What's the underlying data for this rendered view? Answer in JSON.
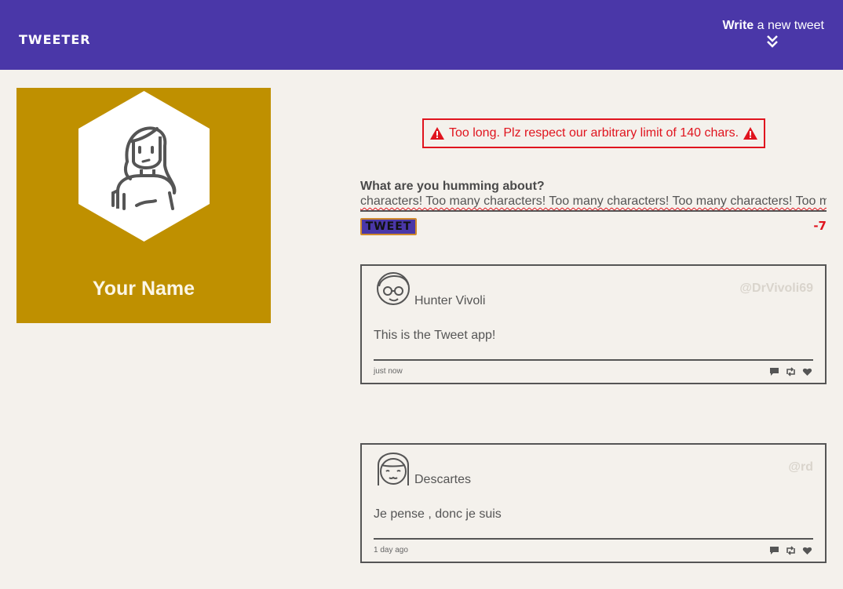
{
  "nav": {
    "brand": "TWEETER",
    "compose_bold": "Write",
    "compose_rest": " a new tweet"
  },
  "profile": {
    "name": "Your Name"
  },
  "error": {
    "message": "Too long. Plz respect our arbitrary limit of 140 chars."
  },
  "compose": {
    "label": "What are you humming about?",
    "text": "characters! Too many characters! Too many characters! Too many characters! Too many characters!",
    "button_label": "TWEET",
    "counter": "-7"
  },
  "tweets": [
    {
      "name": "Hunter Vivoli",
      "handle": "@DrVivoli69",
      "content": "This is the Tweet app!",
      "time": "just now"
    },
    {
      "name": "Descartes",
      "handle": "@rd",
      "content": "Je pense , donc je suis",
      "time": "1 day ago"
    }
  ],
  "colors": {
    "nav": "#4a37a8",
    "profile": "#bf9000",
    "error": "#e0141e",
    "background": "#f4f1ec"
  }
}
